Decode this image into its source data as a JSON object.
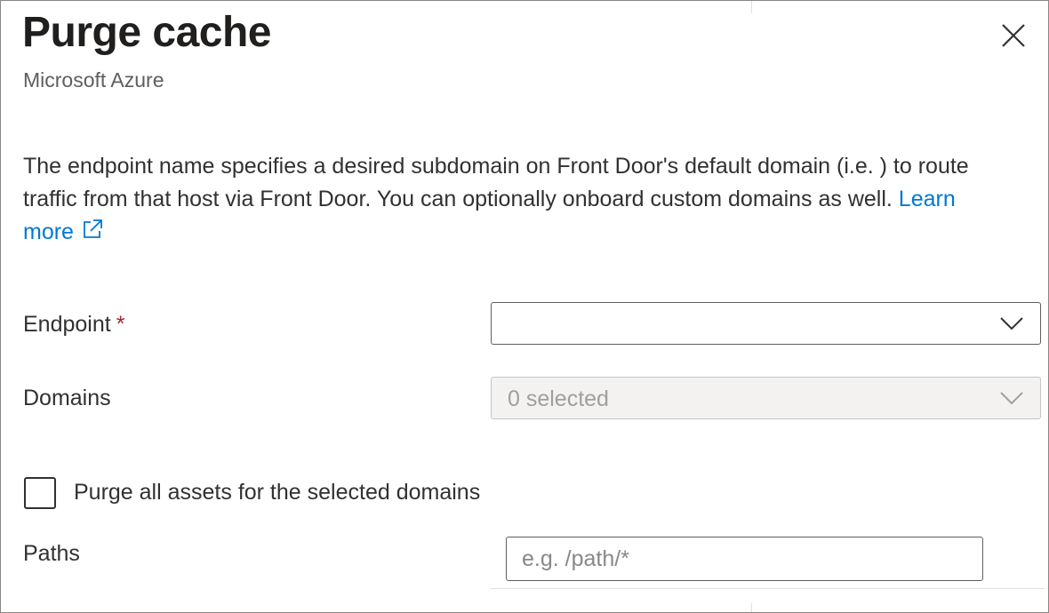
{
  "panel": {
    "title": "Purge cache",
    "subtitle": "Microsoft Azure",
    "close_icon": "close-icon"
  },
  "description": {
    "text": "The endpoint name specifies a desired subdomain on Front Door's default domain (i.e. ) to route traffic from that host via Front Door. You can optionally onboard custom domains as well.",
    "link_label": "Learn more",
    "link_icon": "external-link-icon",
    "link_color": "#0078d4"
  },
  "form": {
    "endpoint": {
      "label": "Endpoint",
      "required_marker": "*",
      "value": "",
      "icon": "chevron-down-icon"
    },
    "domains": {
      "label": "Domains",
      "value": "0 selected",
      "disabled": true,
      "icon": "chevron-down-icon"
    },
    "purge_all": {
      "label": "Purge all assets for the selected domains",
      "checked": false
    },
    "paths": {
      "label": "Paths",
      "placeholder": "e.g. /path/*",
      "value": ""
    }
  },
  "colors": {
    "link": "#0078d4",
    "required": "#a4262c",
    "disabled_bg": "#f3f2f1"
  }
}
